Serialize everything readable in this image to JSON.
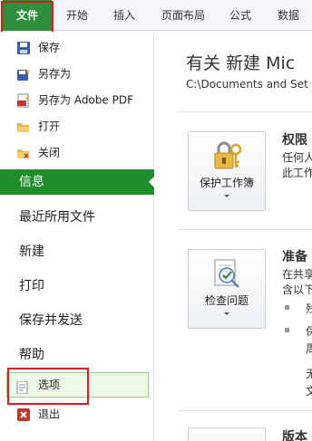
{
  "tabs": [
    {
      "label": "文件"
    },
    {
      "label": "开始"
    },
    {
      "label": "插入"
    },
    {
      "label": "页面布局"
    },
    {
      "label": "公式"
    },
    {
      "label": "数据"
    }
  ],
  "commands": {
    "save": "保存",
    "save_as": "另存为",
    "save_as_pdf": "另存为 Adobe PDF",
    "open": "打开",
    "close": "关闭"
  },
  "nav": {
    "info": "信息",
    "recent": "最近所用文件",
    "new": "新建",
    "print": "打印",
    "save_send": "保存并发送",
    "help": "帮助",
    "options": "选项",
    "exit": "退出"
  },
  "content": {
    "title": "有关 新建 Mic",
    "path": "C:\\Documents and Set",
    "permissions": {
      "button": "保护工作簿",
      "title": "权限",
      "lines": [
        "任何人",
        "此工作"
      ]
    },
    "prepare": {
      "button": "检查问题",
      "title": "准备",
      "lines": [
        "在共享",
        "含以下"
      ],
      "bullet_texts": [
        "残",
        "保",
        "周",
        "无",
        "文"
      ]
    },
    "versions": {
      "title": "版本"
    }
  },
  "colors": {
    "accent_green": "#1e8d2b",
    "highlight_red": "#e0191e"
  }
}
